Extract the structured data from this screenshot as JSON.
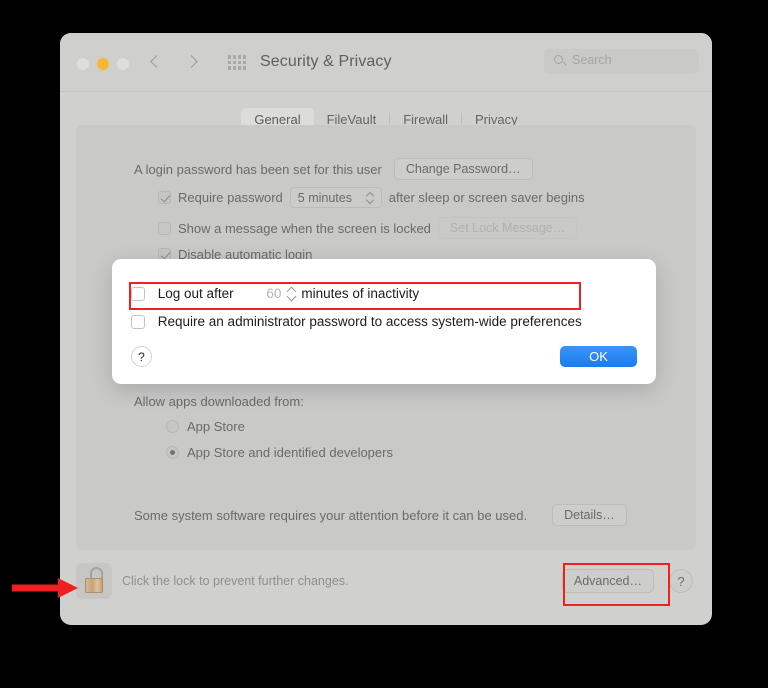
{
  "window": {
    "title": "Security & Privacy",
    "traffic_lights": [
      "close-button",
      "minimize-button",
      "maximize-button"
    ],
    "nav_back": "back-icon",
    "nav_forward": "forward-icon",
    "grid": "show-all-icon"
  },
  "search": {
    "placeholder": "Search",
    "icon": "search-icon"
  },
  "tabs": [
    {
      "label": "General",
      "active": true
    },
    {
      "label": "FileVault",
      "active": false
    },
    {
      "label": "Firewall",
      "active": false
    },
    {
      "label": "Privacy",
      "active": false
    }
  ],
  "general": {
    "login_password_text": "A login password has been set for this user",
    "change_password_button": "Change Password…",
    "require_password_label": "Require password",
    "require_password_checked": true,
    "require_password_interval": "5 minutes",
    "require_password_suffix": "after sleep or screen saver begins",
    "show_message_label": "Show a message when the screen is locked",
    "show_message_checked": false,
    "set_lock_message_button": "Set Lock Message…",
    "disable_auto_login_label": "Disable automatic login",
    "disable_auto_login_checked": true,
    "allow_apps_label": "Allow apps downloaded from:",
    "radio_app_store": "App Store",
    "radio_app_store_identified": "App Store and identified developers",
    "radio_selected": "App Store and identified developers",
    "system_software_text": "Some system software requires your attention before it can be used.",
    "details_button": "Details…"
  },
  "bottom_bar": {
    "lock_icon": "unlocked-padlock-icon",
    "lock_text": "Click the lock to prevent further changes.",
    "advanced_button": "Advanced…",
    "help_button": "?"
  },
  "dialog": {
    "log_out_after_label": "Log out after",
    "log_out_after_checked": false,
    "minutes_value": "60",
    "minutes_suffix": "minutes of inactivity",
    "admin_password_label": "Require an administrator password to access system-wide preferences",
    "admin_password_checked": false,
    "help_button": "?",
    "ok_button": "OK"
  },
  "annotations": {
    "highlight_color": "#f02020",
    "arrow_target": "unlocked-padlock-icon",
    "highlighted_regions": [
      "log-out-after-row",
      "advanced-button"
    ]
  }
}
